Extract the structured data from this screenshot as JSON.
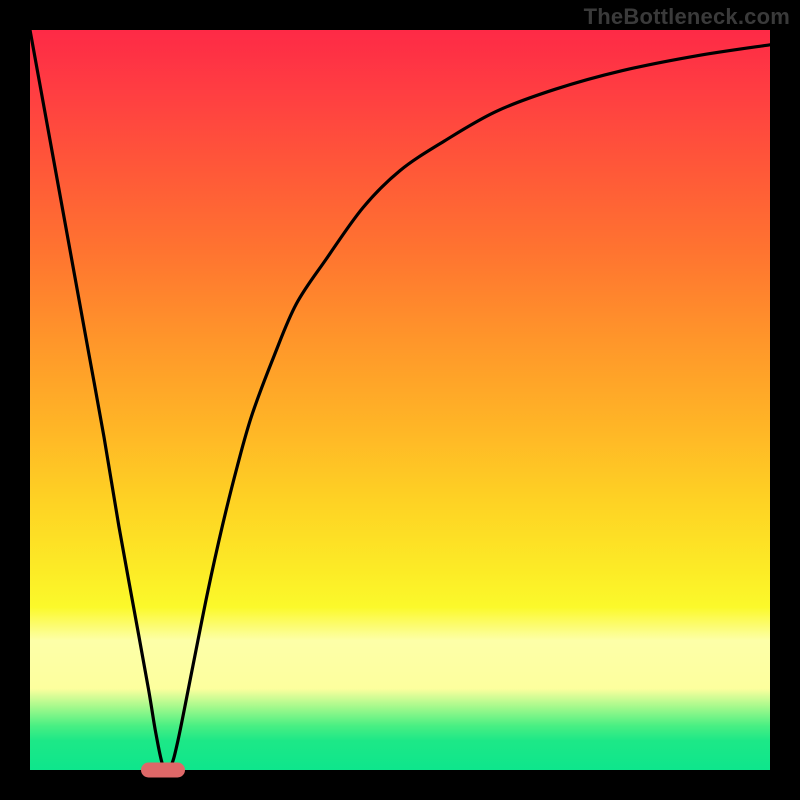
{
  "attribution": "TheBottleneck.com",
  "colors": {
    "frame": "#000000",
    "curve": "#000000",
    "marker": "#de6868"
  },
  "chart_data": {
    "type": "line",
    "title": "",
    "xlabel": "",
    "ylabel": "",
    "xlim": [
      0,
      100
    ],
    "ylim": [
      0,
      100
    ],
    "grid": false,
    "legend": false,
    "background": "vertical-gradient red→orange→yellow→green",
    "series": [
      {
        "name": "bottleneck-curve",
        "x": [
          0,
          2,
          4,
          6,
          8,
          10,
          12,
          14,
          16,
          17,
          18,
          19,
          20,
          22,
          24,
          26,
          28,
          30,
          33,
          36,
          40,
          45,
          50,
          56,
          63,
          71,
          80,
          90,
          100
        ],
        "y": [
          100,
          89,
          78,
          67,
          56,
          45,
          33,
          22,
          11,
          5,
          0.5,
          0.5,
          4,
          14,
          24,
          33,
          41,
          48,
          56,
          63,
          69,
          76,
          81,
          85,
          89,
          92,
          94.5,
          96.5,
          98
        ]
      }
    ],
    "marker": {
      "x": 18,
      "y": 0,
      "color": "#de6868"
    },
    "notes": "Values estimated from pixels. y-axis is fraction of frame height from bottom (0) to top (100)."
  }
}
